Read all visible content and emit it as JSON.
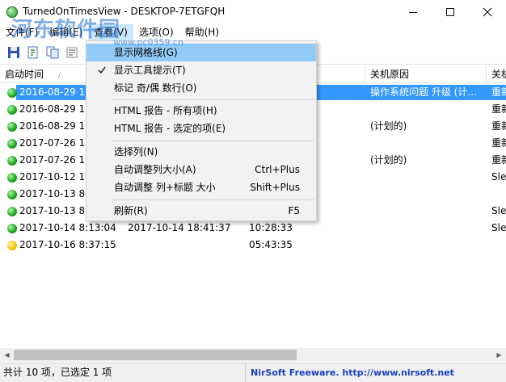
{
  "window": {
    "title": "TurnedOnTimesView  -  DESKTOP-7ETGFQH"
  },
  "watermark": {
    "main": "河东软件园",
    "sub": "www.pc0359.cn"
  },
  "menubar": {
    "items": [
      {
        "label": "文件(F)"
      },
      {
        "label": "编辑(E)"
      },
      {
        "label": "查看(V)"
      },
      {
        "label": "选项(O)"
      },
      {
        "label": "帮助(H)"
      }
    ]
  },
  "toolbar": {
    "icons": [
      "save-icon",
      "export-icon",
      "copy-icon",
      "properties-icon"
    ]
  },
  "columns": [
    {
      "label": "启动时间"
    },
    {
      "label": "关机原因"
    },
    {
      "label": "关机"
    }
  ],
  "rows": [
    {
      "status": "green",
      "start": "2016-08-29 17",
      "end": "",
      "duration": "",
      "reason": "操作系统问题 升级 (计...",
      "extra": "重新"
    },
    {
      "status": "green",
      "start": "2016-08-29 17",
      "end": "",
      "duration": "",
      "reason": "",
      "extra": "重新"
    },
    {
      "status": "green",
      "start": "2016-08-29 18",
      "end": "",
      "duration": "",
      "reason": "(计划的)",
      "extra": "重新"
    },
    {
      "status": "green",
      "start": "2017-07-26 18",
      "end": "",
      "duration": "",
      "reason": "",
      "extra": "重新"
    },
    {
      "status": "green",
      "start": "2017-07-26 18",
      "end": "",
      "duration": "",
      "reason": "(计划的)",
      "extra": "重新"
    },
    {
      "status": "green",
      "start": "2017-10-12 18",
      "end": "",
      "duration": "",
      "reason": "",
      "extra": "Sle"
    },
    {
      "status": "green",
      "start": "2017-10-13 8:",
      "end": "",
      "duration": "",
      "reason": "",
      "extra": ""
    },
    {
      "status": "green",
      "start": "2017-10-13 8:",
      "end": "",
      "duration": "",
      "reason": "",
      "extra": "Sle"
    },
    {
      "status": "green",
      "start": "2017-10-14 8:13:04",
      "end": "2017-10-14 18:41:37",
      "duration": "10:28:33",
      "reason": "",
      "extra": "Sle"
    },
    {
      "status": "yellow",
      "start": "2017-10-16 8:37:15",
      "end": "",
      "duration": "05:43:35",
      "reason": "",
      "extra": ""
    }
  ],
  "selected_row": 0,
  "statusbar": {
    "left": "共计 10 项，已选定 1 项",
    "right": "NirSoft Freeware.  http://www.nirsoft.net"
  },
  "view_menu": {
    "items": [
      {
        "label": "显示网格线(G)",
        "shortcut": "",
        "checked": false
      },
      {
        "label": "显示工具提示(T)",
        "shortcut": "",
        "checked": true
      },
      {
        "label": "标记 奇/偶 数行(O)",
        "shortcut": "",
        "checked": false
      },
      {
        "label": "HTML 报告 - 所有项(H)",
        "shortcut": "",
        "checked": false
      },
      {
        "label": "HTML 报告 - 选定的项(E)",
        "shortcut": "",
        "checked": false
      },
      {
        "label": "选择列(N)",
        "shortcut": "",
        "checked": false
      },
      {
        "label": "自动调整列大小(A)",
        "shortcut": "Ctrl+Plus",
        "checked": false
      },
      {
        "label": "自动调整 列+标题 大小",
        "shortcut": "Shift+Plus",
        "checked": false
      },
      {
        "label": "刷新(R)",
        "shortcut": "F5",
        "checked": false
      }
    ]
  },
  "colors": {
    "selection": "#3399ff",
    "menu_hover": "#91c9f7",
    "link": "#1a3fc4"
  }
}
